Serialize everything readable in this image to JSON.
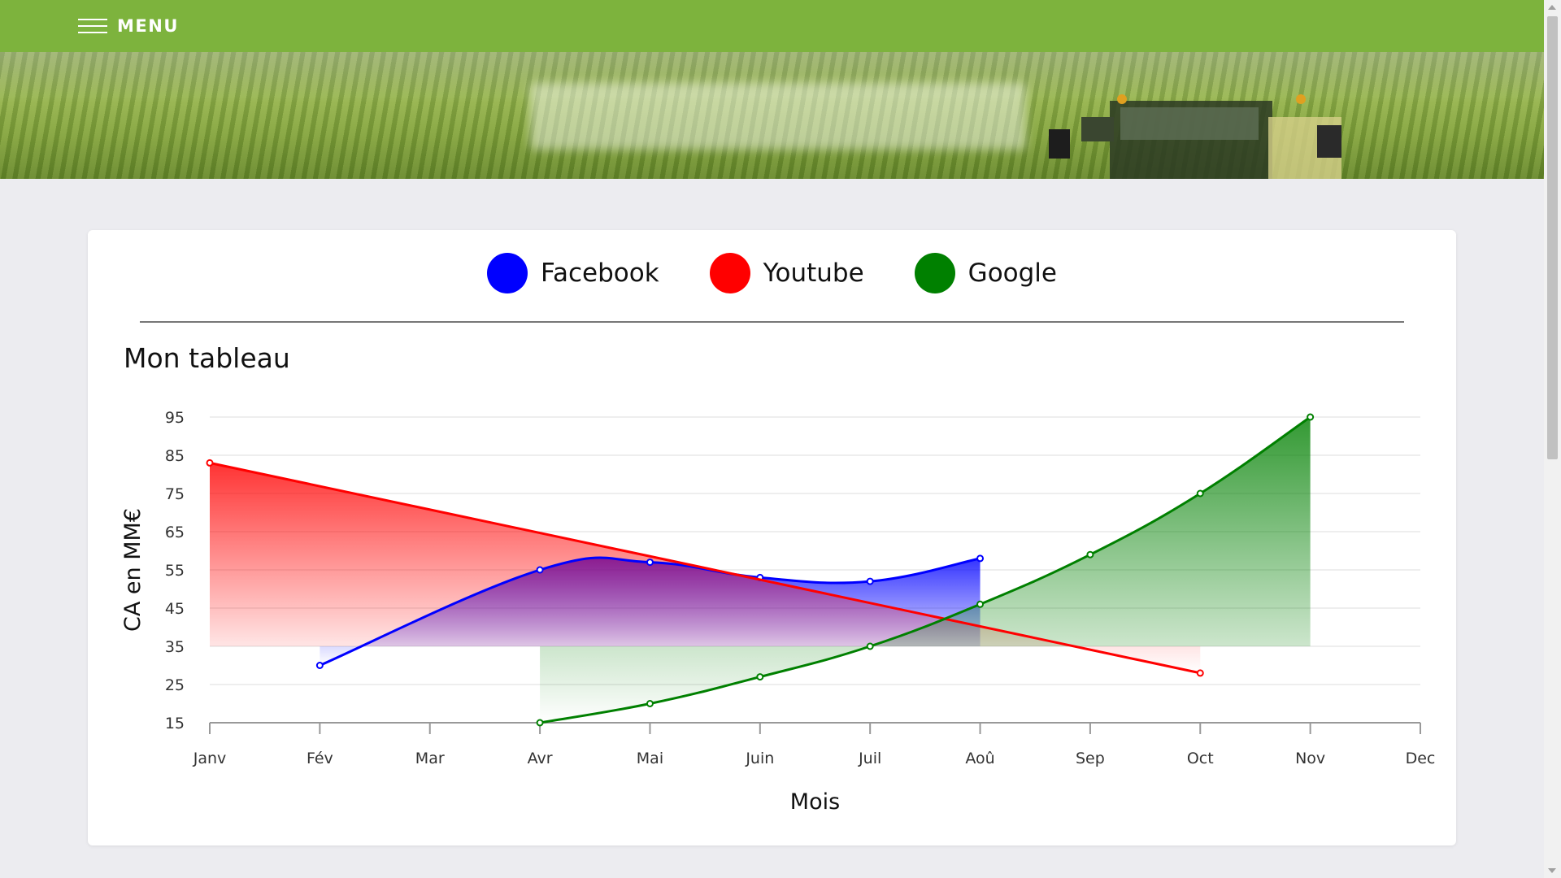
{
  "menu": {
    "label": "MENU"
  },
  "legend": [
    {
      "name": "Facebook",
      "color": "#0000ff"
    },
    {
      "name": "Youtube",
      "color": "#ff0000"
    },
    {
      "name": "Google",
      "color": "#008000"
    }
  ],
  "chart_data": {
    "type": "line",
    "title": "Mon tableau",
    "xlabel": "Mois",
    "ylabel": "CA en MM€",
    "categories": [
      "Janv",
      "Fév",
      "Mar",
      "Avr",
      "Mai",
      "Juin",
      "Juil",
      "Aoû",
      "Sep",
      "Oct",
      "Nov",
      "Dec"
    ],
    "yticks": [
      95,
      85,
      75,
      65,
      55,
      45,
      35,
      25,
      15
    ],
    "ylim": [
      15,
      95
    ],
    "grid": true,
    "legend_position": "top",
    "series": [
      {
        "name": "Facebook",
        "color": "#0000ff",
        "fill": true,
        "values": [
          null,
          30,
          null,
          55,
          57,
          53,
          52,
          58,
          null,
          null,
          null,
          null
        ]
      },
      {
        "name": "Youtube",
        "color": "#ff0000",
        "fill": true,
        "values": [
          83,
          null,
          null,
          null,
          null,
          null,
          null,
          null,
          null,
          28,
          null,
          null
        ]
      },
      {
        "name": "Google",
        "color": "#008000",
        "fill": true,
        "values": [
          null,
          null,
          null,
          15,
          20,
          27,
          35,
          46,
          59,
          75,
          95,
          null
        ]
      }
    ]
  }
}
